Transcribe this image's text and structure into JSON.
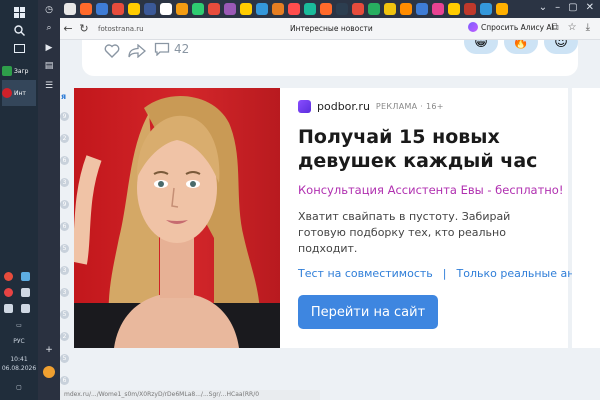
{
  "taskbar": {
    "apps": [
      {
        "label": "Загр",
        "color": "#2e9e4a"
      },
      {
        "label": "Инт",
        "color": "#d0212a"
      }
    ],
    "tray": {
      "lang": "РУС",
      "time": "10:41",
      "date": "06.08.2026"
    }
  },
  "tabs": {
    "favicon_colors": [
      "#e8e8e8",
      "#ff6a2b",
      "#3e7cd6",
      "#e74c3c",
      "#ffcc00",
      "#3b5998",
      "#ffffff",
      "#f39c12",
      "#2ecc71",
      "#e74c3c",
      "#9b59b6",
      "#ffcc00",
      "#3498db",
      "#e67e22",
      "#ff4d4d",
      "#1abc9c",
      "#ff6a2b",
      "#2c3e50",
      "#e74c3c",
      "#27ae60",
      "#f1c40f",
      "#ff8c00",
      "#3e7cd6",
      "#e84393",
      "#ffcc00",
      "#c0392b",
      "#3498db",
      "#ffb000"
    ]
  },
  "address": {
    "url": "fotostrana.ru",
    "title": "Интересные новости",
    "alice": "Спросить Алису AI"
  },
  "post": {
    "comment_count": "42",
    "reactions": [
      "😁",
      "🔥",
      "😍"
    ]
  },
  "leftStrip": {
    "letter": "я",
    "numbers": [
      "9",
      "2",
      "6",
      "3",
      "9",
      "6",
      "5",
      "3",
      "3",
      "5",
      "2",
      "5",
      "6",
      "2"
    ]
  },
  "ad": {
    "sponsor": "podbor.ru",
    "tag": "РЕКЛАМА · 16+",
    "headline": "Получай 15 новых девушек каждый час",
    "subline": "Консультация Ассистента Евы - бесплатно!",
    "description": "Хватит свайпать в пустоту. Забирай готовую подборку тех, кто реально подходит.",
    "link1": "Тест на совместимость",
    "separator": "|",
    "link2": "Только реальные анкеты",
    "cta": "Перейти на сайт"
  },
  "status": {
    "text": "mdex.ru/.../Wome1_s0m/X0RzyD/rDe6MLa8.../...Sgr/...HCaa(RR/0"
  }
}
